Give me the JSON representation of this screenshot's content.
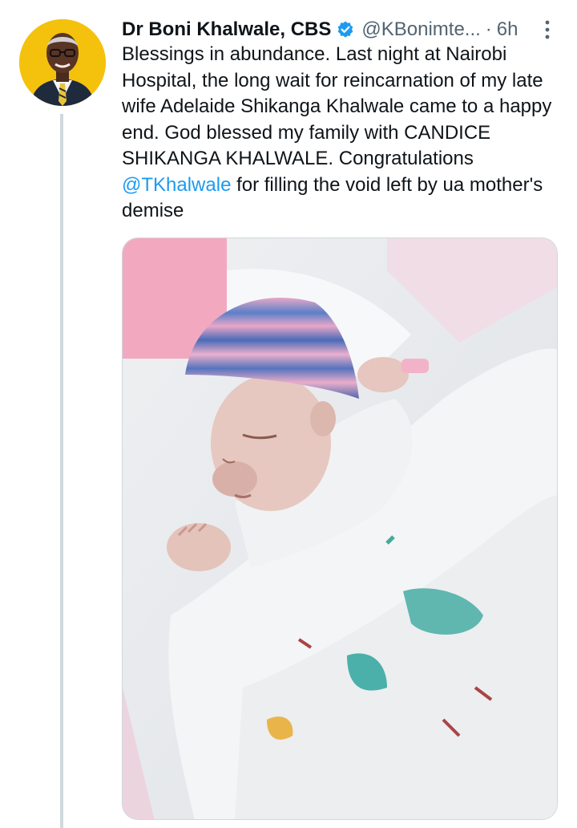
{
  "tweet": {
    "author_name": "Dr Boni Khalwale, CBS",
    "handle": "@KBonimte...",
    "separator": "·",
    "time": "6h",
    "text_parts": {
      "before_mention": "Blessings in abundance. Last night at Nairobi Hospital, the long wait for reincarnation of my late wife Adelaide Shikanga Khalwale came to a happy end. God blessed my family with CANDICE SHIKANGA KHALWALE. Congratulations ",
      "mention": "@TKhalwale",
      "after_mention": " for filling the void left by ua mother's demise"
    }
  },
  "colors": {
    "text": "#0f1419",
    "secondary": "#536471",
    "link": "#1d9bf0",
    "verified": "#1d9bf0",
    "avatar_bg": "#f4c20d",
    "thread_line": "#cfd9de"
  },
  "icons": {
    "verified": "verified-badge-icon",
    "more": "more-options-icon"
  }
}
